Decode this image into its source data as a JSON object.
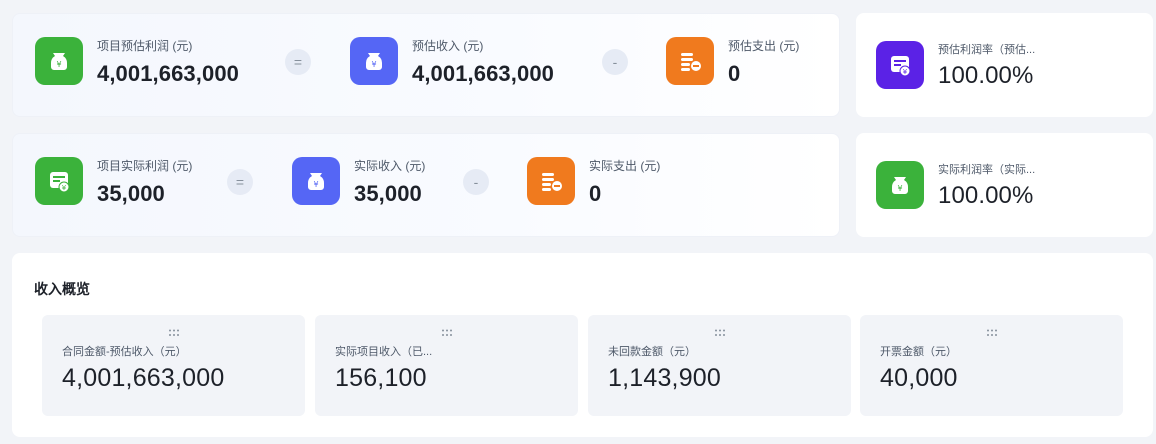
{
  "estimate_row": {
    "profit": {
      "label": "项目预估利润 (元)",
      "value": "4,001,663,000",
      "icon": "money-bag-icon"
    },
    "op1": "=",
    "income": {
      "label": "预估收入 (元)",
      "value": "4,001,663,000",
      "icon": "money-bag-icon"
    },
    "op2": "-",
    "expense": {
      "label": "预估支出 (元)",
      "value": "0",
      "icon": "coins-minus-icon"
    }
  },
  "estimate_rate": {
    "label": "预估利润率（预估...",
    "value": "100.00%",
    "icon": "invoice-yuan-icon"
  },
  "actual_row": {
    "profit": {
      "label": "项目实际利润 (元)",
      "value": "35,000",
      "icon": "invoice-yuan-icon"
    },
    "op1": "=",
    "income": {
      "label": "实际收入 (元)",
      "value": "35,000",
      "icon": "money-bag-icon"
    },
    "op2": "-",
    "expense": {
      "label": "实际支出 (元)",
      "value": "0",
      "icon": "coins-minus-icon"
    }
  },
  "actual_rate": {
    "label": "实际利润率（实际...",
    "value": "100.00%",
    "icon": "money-bag-icon"
  },
  "overview": {
    "title": "收入概览",
    "tiles": [
      {
        "label": "合同金额-预估收入（元）",
        "value": "4,001,663,000"
      },
      {
        "label": "实际项目收入（已...",
        "value": "156,100"
      },
      {
        "label": "未回款金额（元）",
        "value": "1,143,900"
      },
      {
        "label": "开票金额（元）",
        "value": "40,000"
      }
    ]
  },
  "colors": {
    "green": "#3bb23b",
    "blue": "#5566f5",
    "orange": "#f07a1e",
    "purple": "#5b22e6"
  }
}
